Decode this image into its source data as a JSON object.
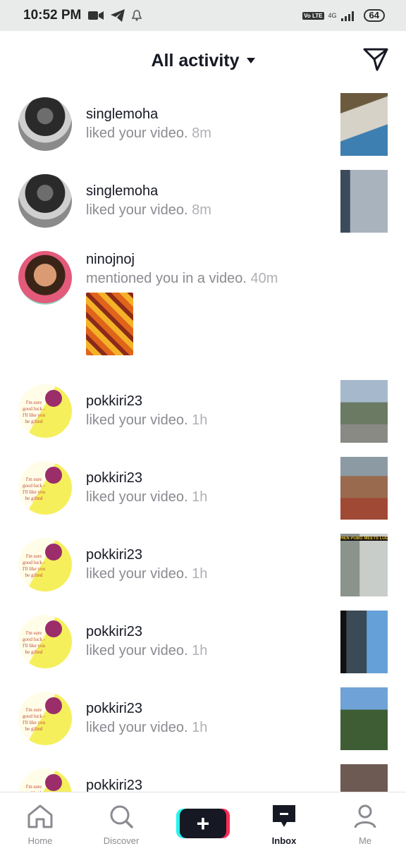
{
  "status_bar": {
    "time": "10:52 PM",
    "lte": "Vo LTE",
    "network": "4G",
    "battery": "64"
  },
  "header": {
    "title": "All activity"
  },
  "activities": [
    {
      "username": "singlemoha",
      "action": "liked your video.",
      "time": "8m"
    },
    {
      "username": "singlemoha",
      "action": "liked your video.",
      "time": "8m"
    },
    {
      "username": "ninojnoj",
      "action": "mentioned you in a video.",
      "time": "40m"
    },
    {
      "username": "pokkiri23",
      "action": "liked your video.",
      "time": "1h"
    },
    {
      "username": "pokkiri23",
      "action": "liked your video.",
      "time": "1h"
    },
    {
      "username": "pokkiri23",
      "action": "liked your video.",
      "time": "1h",
      "thumb_label": "HEN PUBG MEETS LUDO K"
    },
    {
      "username": "pokkiri23",
      "action": "liked your video.",
      "time": "1h"
    },
    {
      "username": "pokkiri23",
      "action": "liked your video.",
      "time": "1h"
    },
    {
      "username": "pokkiri23"
    }
  ],
  "avatar_text": "I'm sure good luck - I'll like you be gifted",
  "bottom_nav": {
    "home": "Home",
    "discover": "Discover",
    "inbox": "Inbox",
    "me": "Me"
  }
}
